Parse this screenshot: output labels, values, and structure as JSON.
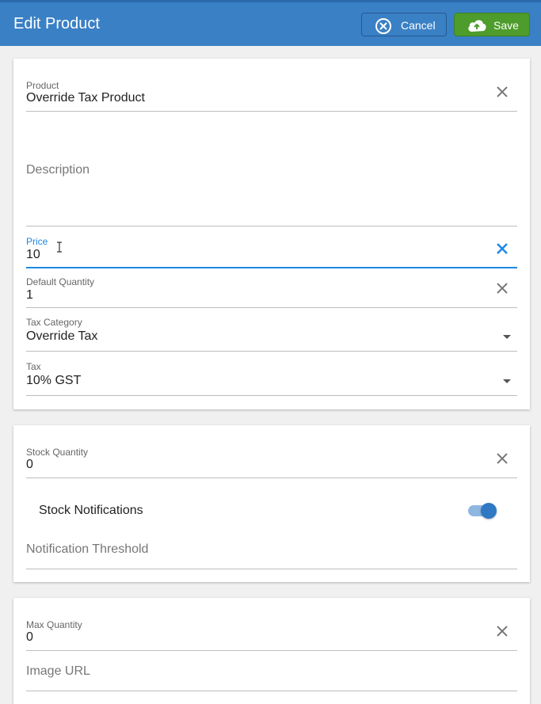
{
  "header": {
    "title": "Edit Product",
    "cancel_label": "Cancel",
    "save_label": "Save"
  },
  "colors": {
    "appbar": "#3a80c5",
    "save_button": "#4d9c2c",
    "focus_accent": "#1e88e5",
    "toggle_on": "#2f78c4"
  },
  "product_card": {
    "product": {
      "label": "Product",
      "value": "Override Tax Product"
    },
    "description": {
      "placeholder": "Description"
    },
    "price": {
      "label": "Price",
      "value": "10"
    },
    "default_quantity": {
      "label": "Default Quantity",
      "value": "1"
    },
    "tax_category": {
      "label": "Tax Category",
      "value": "Override Tax"
    },
    "tax": {
      "label": "Tax",
      "value": "10% GST"
    }
  },
  "stock_card": {
    "stock_quantity": {
      "label": "Stock Quantity",
      "value": "0"
    },
    "stock_notifications": {
      "label": "Stock Notifications",
      "enabled": true
    },
    "notification_threshold": {
      "placeholder": "Notification Threshold"
    }
  },
  "extra_card": {
    "max_quantity": {
      "label": "Max Quantity",
      "value": "0"
    },
    "image_url": {
      "placeholder": "Image URL"
    }
  },
  "icons": [
    "close-circle-icon",
    "cloud-upload-icon",
    "clear-icon",
    "dropdown-caret-icon",
    "text-cursor-icon"
  ]
}
